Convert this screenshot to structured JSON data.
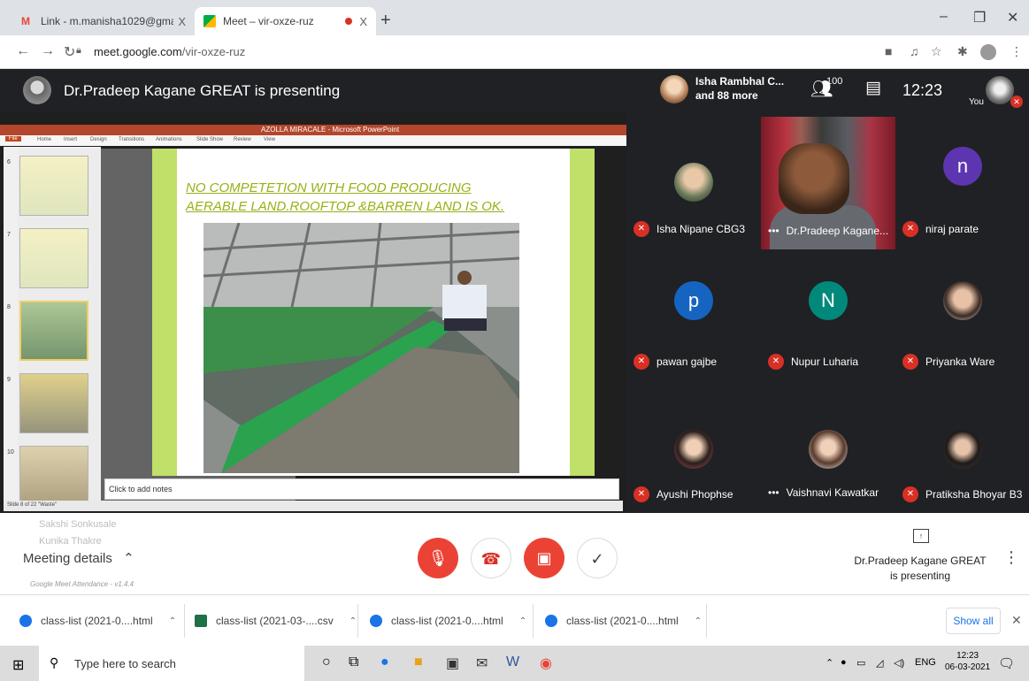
{
  "browser": {
    "tabs": [
      {
        "title": "Link - m.manisha1029@gmail.cc",
        "close": "X"
      },
      {
        "title": "Meet – vir-oxze-ruz",
        "close": "X"
      }
    ],
    "new_tab": "+",
    "url_domain": "meet.google.com",
    "url_path": "/vir-oxze-ruz"
  },
  "meet": {
    "presenting_title": "Dr.Pradeep Kagane GREAT is presenting",
    "top_participant_line1": "Isha Rambhal C...",
    "top_participant_line2": "and 88 more",
    "people_count": "100",
    "clock": "12:23",
    "you_label": "You"
  },
  "presentation": {
    "ppt_title": "AZOLLA MIRACALE - Microsoft PowerPoint",
    "ribbon": [
      "Home",
      "Insert",
      "Design",
      "Transitions",
      "Animations",
      "Slide Show",
      "Review",
      "View"
    ],
    "file_tab": "File",
    "slide_heading_line1": "NO COMPETETION WITH FOOD PRODUCING",
    "slide_heading_line2": "AERABLE  LAND.ROOFTOP &BARREN LAND IS OK.",
    "notes_placeholder": "Click to add notes",
    "status": "Slide 8 of 22   \"Waste\"",
    "thumb_numbers": [
      "6",
      "7",
      "8",
      "9",
      "10"
    ]
  },
  "participants": [
    {
      "name": "Isha Nipane CBG3",
      "avatar": "photo",
      "muted": true
    },
    {
      "name": "Dr.Pradeep Kagane...",
      "avatar": "video",
      "muted": false
    },
    {
      "name": "niraj parate",
      "avatar": "n",
      "color": "#5e35b1",
      "muted": true
    },
    {
      "name": "pawan gajbe",
      "avatar": "p",
      "color": "#1565c0",
      "muted": true
    },
    {
      "name": "Nupur Luharia",
      "avatar": "N",
      "color": "#00897b",
      "muted": true
    },
    {
      "name": "Priyanka Ware",
      "avatar": "photo",
      "muted": true
    },
    {
      "name": "Ayushi Phophse",
      "avatar": "photo",
      "muted": true
    },
    {
      "name": "Vaishnavi Kawatkar",
      "avatar": "photo",
      "muted": false
    },
    {
      "name": "Pratiksha Bhoyar B3",
      "avatar": "photo",
      "muted": true
    }
  ],
  "bottom": {
    "meeting_details": "Meeting details",
    "attendance": "Google Meet Attendance - v1.4.4",
    "ghost_names": [
      "Sakshi Sonkusale",
      "Kunika Thakre"
    ],
    "present_line1": "Dr.Pradeep Kagane GREAT",
    "present_line2": "is presenting"
  },
  "downloads": {
    "items": [
      "class-list (2021-0....html",
      "class-list (2021-03-....csv",
      "class-list (2021-0....html",
      "class-list (2021-0....html"
    ],
    "show_all": "Show all"
  },
  "taskbar": {
    "search_placeholder": "Type here to search",
    "lang": "ENG",
    "time": "12:23",
    "date": "06-03-2021",
    "notif_count": "6"
  }
}
